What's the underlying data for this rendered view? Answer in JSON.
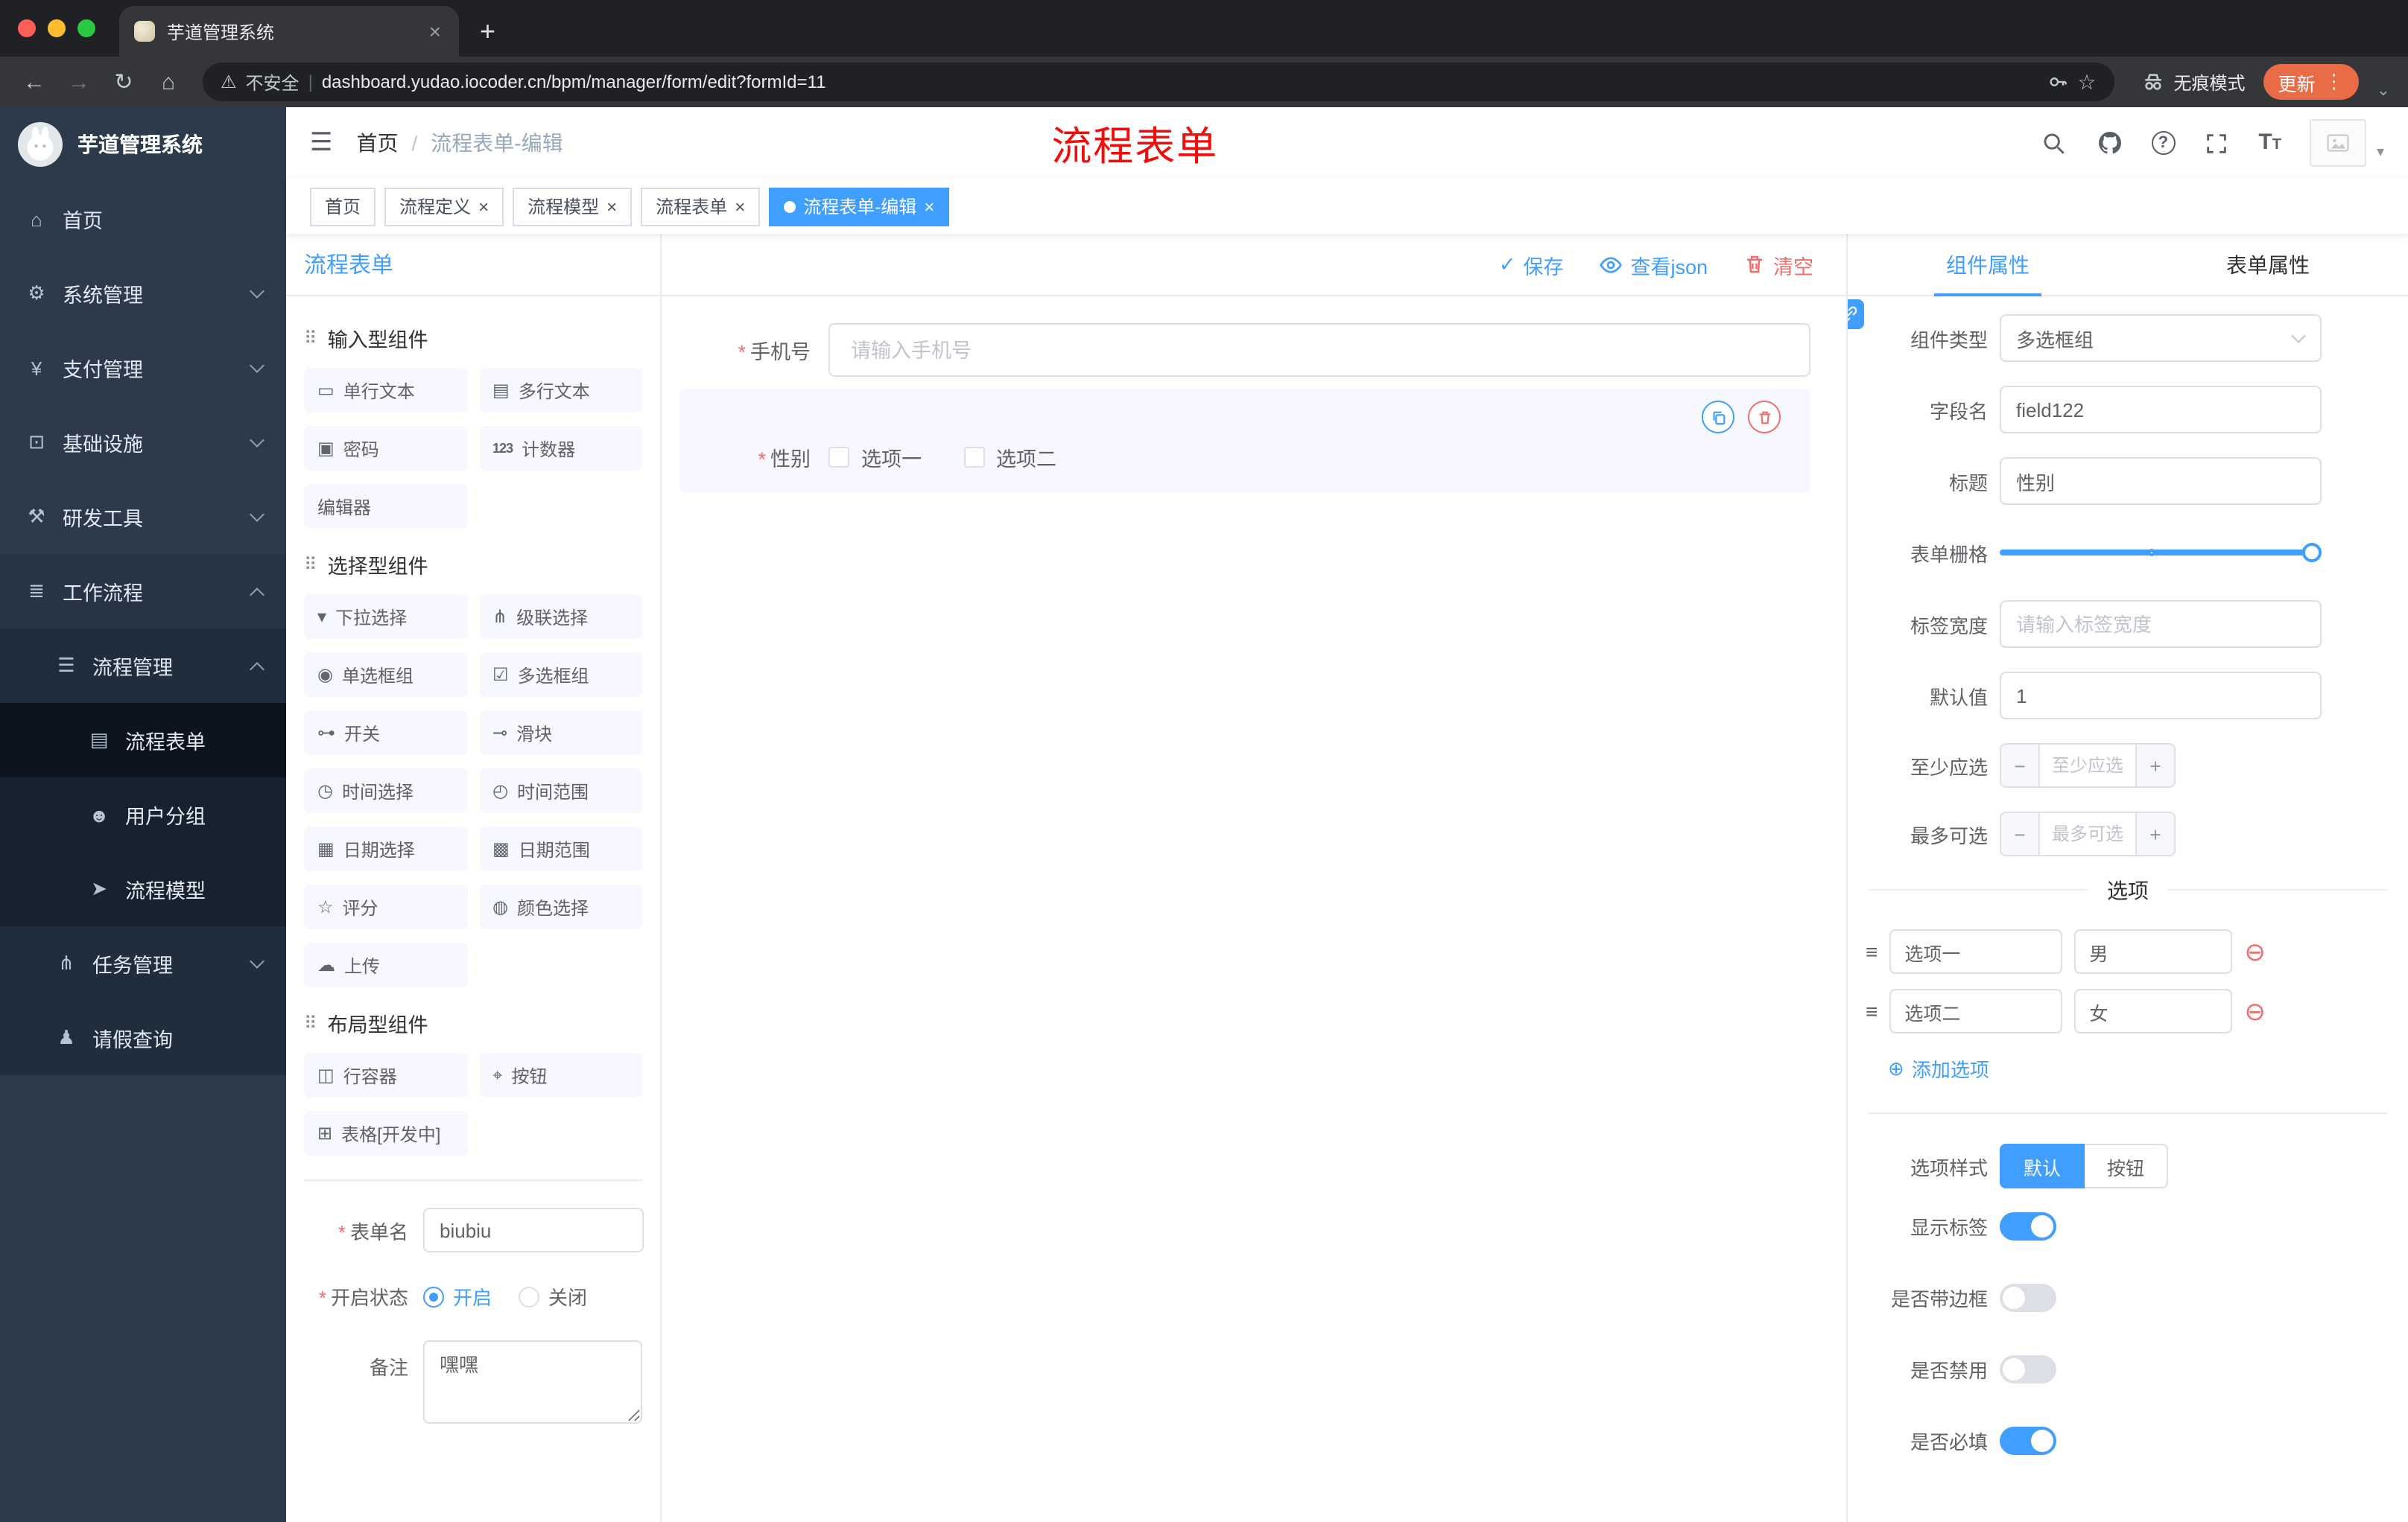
{
  "chrome": {
    "tab_title": "芋道管理系统",
    "security_label": "不安全",
    "url": "dashboard.yudao.iocoder.cn/bpm/manager/form/edit?formId=11",
    "incognito_label": "无痕模式",
    "update_label": "更新"
  },
  "icons": {
    "back": "←",
    "forward": "→",
    "reload": "↻",
    "home": "⌂",
    "warning": "⚠",
    "pipe": "|",
    "star": "☆",
    "menu_dots": "⋮",
    "new_tab": "+",
    "close": "×",
    "hamburger": "☰",
    "question": "?",
    "text_big": "T",
    "text_small": "T",
    "check": "✓",
    "group_drag": "⠿",
    "option_drag": "≡",
    "remove_circle": "⊖",
    "add_circle": "⊕",
    "minus": "−",
    "plus": "+",
    "required": "*",
    "window_caret": "⌄",
    "caret_small": "▾"
  },
  "sidebar": {
    "logo_title": "芋道管理系统",
    "items": [
      {
        "label": "首页",
        "icon": "⌂"
      },
      {
        "label": "系统管理",
        "icon": "⚙"
      },
      {
        "label": "支付管理",
        "icon": "¥"
      },
      {
        "label": "基础设施",
        "icon": "⊡"
      },
      {
        "label": "研发工具",
        "icon": "⚒"
      },
      {
        "label": "工作流程",
        "icon": "≣"
      },
      {
        "label": "流程管理",
        "icon": "☰"
      },
      {
        "label": "流程表单",
        "icon": "▤"
      },
      {
        "label": "用户分组",
        "icon": "☻"
      },
      {
        "label": "流程模型",
        "icon": "➤"
      },
      {
        "label": "任务管理",
        "icon": "⋔"
      },
      {
        "label": "请假查询",
        "icon": "♟"
      }
    ]
  },
  "header": {
    "breadcrumb_home": "首页",
    "breadcrumb_sep": "/",
    "breadcrumb_current": "流程表单-编辑",
    "overlay_title": "流程表单"
  },
  "tags": [
    {
      "label": "首页"
    },
    {
      "label": "流程定义"
    },
    {
      "label": "流程模型"
    },
    {
      "label": "流程表单"
    },
    {
      "label": "流程表单-编辑"
    }
  ],
  "palette": {
    "title": "流程表单",
    "groups": {
      "input": {
        "title": "输入型组件",
        "items": [
          {
            "label": "单行文本",
            "icon": "▭"
          },
          {
            "label": "多行文本",
            "icon": "▤"
          },
          {
            "label": "密码",
            "icon": "▣"
          },
          {
            "label": "计数器",
            "icon": "123"
          },
          {
            "label": "编辑器",
            "icon": ""
          }
        ]
      },
      "select": {
        "title": "选择型组件",
        "items": [
          {
            "label": "下拉选择",
            "icon": "▾"
          },
          {
            "label": "级联选择",
            "icon": "⋔"
          },
          {
            "label": "单选框组",
            "icon": "◉"
          },
          {
            "label": "多选框组",
            "icon": "☑"
          },
          {
            "label": "开关",
            "icon": "⊶"
          },
          {
            "label": "滑块",
            "icon": "⊸"
          },
          {
            "label": "时间选择",
            "icon": "◷"
          },
          {
            "label": "时间范围",
            "icon": "◴"
          },
          {
            "label": "日期选择",
            "icon": "▦"
          },
          {
            "label": "日期范围",
            "icon": "▩"
          },
          {
            "label": "评分",
            "icon": "☆"
          },
          {
            "label": "颜色选择",
            "icon": "◍"
          },
          {
            "label": "上传",
            "icon": "☁"
          }
        ]
      },
      "layout": {
        "title": "布局型组件",
        "items": [
          {
            "label": "行容器",
            "icon": "◫"
          },
          {
            "label": "按钮",
            "icon": "⌖"
          },
          {
            "label": "表格[开发中]",
            "icon": "⊞"
          }
        ]
      }
    },
    "meta": {
      "name_label": "表单名",
      "name_value": "biubiu",
      "status_label": "开启状态",
      "status_on": "开启",
      "status_off": "关闭",
      "remark_label": "备注",
      "remark_value": "嘿嘿"
    }
  },
  "canvas": {
    "actions": {
      "save": "保存",
      "view_json": "查看json",
      "clear": "清空"
    },
    "phone": {
      "label": "手机号",
      "placeholder": "请输入手机号"
    },
    "gender": {
      "label": "性别",
      "option1": "选项一",
      "option2": "选项二"
    }
  },
  "props": {
    "tabs": {
      "component": "组件属性",
      "form": "表单属性"
    },
    "type": {
      "label": "组件类型",
      "value": "多选框组"
    },
    "field": {
      "label": "字段名",
      "value": "field122"
    },
    "title": {
      "label": "标题",
      "value": "性别"
    },
    "grid": {
      "label": "表单栅格"
    },
    "label_width": {
      "label": "标签宽度",
      "placeholder": "请输入标签宽度"
    },
    "default": {
      "label": "默认值",
      "value": "1"
    },
    "min": {
      "label": "至少应选",
      "placeholder": "至少应选"
    },
    "max": {
      "label": "最多可选",
      "placeholder": "最多可选"
    },
    "options_title": "选项",
    "options": [
      {
        "label": "选项一",
        "value": "男"
      },
      {
        "label": "选项二",
        "value": "女"
      }
    ],
    "add_option": "添加选项",
    "style": {
      "label": "选项样式",
      "default": "默认",
      "button": "按钮"
    },
    "switches": {
      "show_label": "显示标签",
      "border_label": "是否带边框",
      "disabled_label": "是否禁用",
      "required_label": "是否必填"
    }
  },
  "colors": {
    "accent": "#409EFF",
    "danger": "#F56C6C",
    "overlay_red": "#F20D0D",
    "update_pill": "#E96C47",
    "sidebar_bg": "#2D3A4B",
    "submenu_bg": "#1F2D3D",
    "selected_block_bg": "#F6F7FF"
  }
}
